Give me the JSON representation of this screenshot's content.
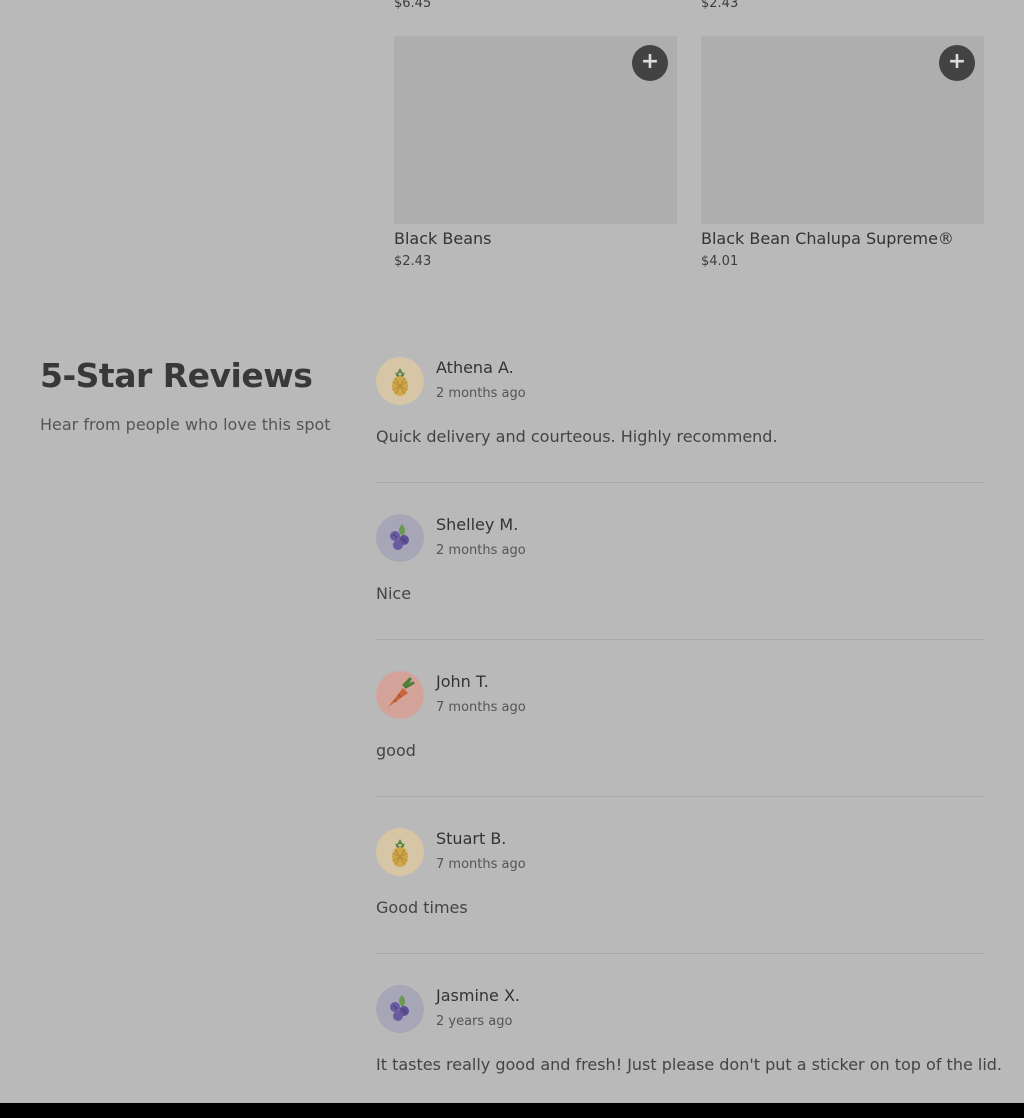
{
  "products_top_prices": [
    "$6.45",
    "$2.43"
  ],
  "products": [
    {
      "name": "Black Beans",
      "price": "$2.43",
      "add_label": "+"
    },
    {
      "name": "Black Bean Chalupa Supreme®",
      "price": "$4.01",
      "add_label": "+"
    }
  ],
  "reviews_section": {
    "title": "5-Star Reviews",
    "subtitle": "Hear from people who love this spot"
  },
  "reviews": [
    {
      "name": "Athena A.",
      "time": "2 months ago",
      "text": "Quick delivery and courteous. Highly recommend.",
      "avatar": "pineapple-icon"
    },
    {
      "name": "Shelley M.",
      "time": "2 months ago",
      "text": "Nice",
      "avatar": "blackberry-icon"
    },
    {
      "name": "John T.",
      "time": "7 months ago",
      "text": "good",
      "avatar": "carrot-icon"
    },
    {
      "name": "Stuart B.",
      "time": "7 months ago",
      "text": "Good times",
      "avatar": "pineapple-icon"
    },
    {
      "name": "Jasmine X.",
      "time": "2 years ago",
      "text": "It tastes really good and fresh! Just please don't put a sticker on top of the lid.",
      "avatar": "blackberry-icon"
    }
  ],
  "colors": {
    "overlay_background": "#b9b9b9",
    "image_placeholder": "#aeaeae",
    "add_button": "#434343",
    "pineapple_bg": "#d6c6a6",
    "blackberry_bg": "#a6a6b6",
    "carrot_bg": "#d3a39a"
  }
}
